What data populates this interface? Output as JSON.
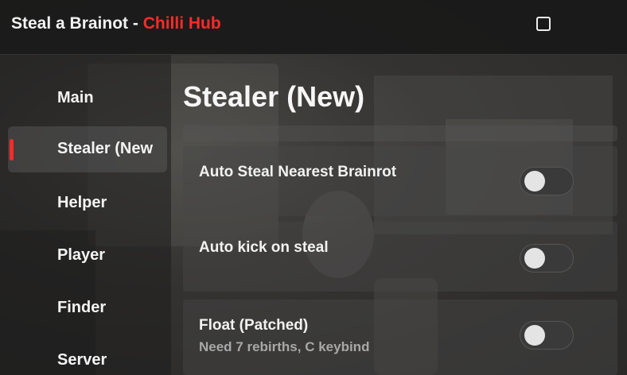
{
  "window": {
    "title_prefix": "Steal a Brainot - ",
    "title_accent": "Chilli Hub",
    "accent_color": "#ff2a2a"
  },
  "sidebar": {
    "items": [
      {
        "label": "Main",
        "active": false
      },
      {
        "label": "Stealer (New",
        "active": true
      },
      {
        "label": "Helper",
        "active": false
      },
      {
        "label": "Player",
        "active": false
      },
      {
        "label": "Finder",
        "active": false
      },
      {
        "label": "Server",
        "active": false
      }
    ]
  },
  "main": {
    "section_title": "Stealer (New)",
    "toggles": [
      {
        "label": "Auto Steal Nearest Brainrot",
        "sublabel": "",
        "enabled": false
      },
      {
        "label": "Auto kick on steal",
        "sublabel": "",
        "enabled": false
      },
      {
        "label": "Float (Patched)",
        "sublabel": "Need 7 rebirths, C keybind",
        "enabled": false
      }
    ]
  },
  "icons": {
    "window_toggle": "square-outline-icon"
  }
}
